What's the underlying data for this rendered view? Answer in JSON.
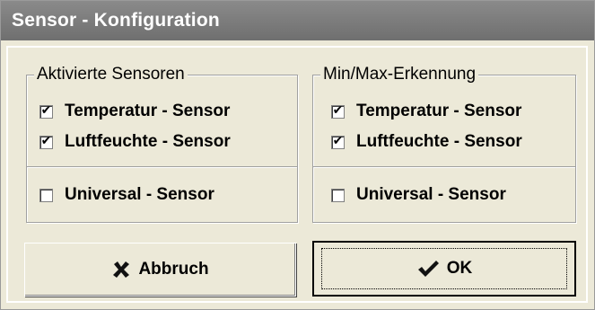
{
  "window": {
    "title": "Sensor - Konfiguration"
  },
  "groups": {
    "active_sensors": {
      "title": "Aktivierte Sensoren",
      "items": [
        {
          "label": "Temperatur - Sensor",
          "checked": true
        },
        {
          "label": "Luftfeuchte - Sensor",
          "checked": true
        },
        {
          "label": "Universal - Sensor",
          "checked": false
        }
      ]
    },
    "minmax": {
      "title": "Min/Max-Erkennung",
      "items": [
        {
          "label": "Temperatur - Sensor",
          "checked": true
        },
        {
          "label": "Luftfeuchte - Sensor",
          "checked": true
        },
        {
          "label": "Universal - Sensor",
          "checked": false
        }
      ]
    }
  },
  "buttons": {
    "cancel_label": "Abbruch",
    "ok_label": "OK"
  },
  "icons": {
    "check_glyph": "✔",
    "cancel_glyph": "✖"
  }
}
